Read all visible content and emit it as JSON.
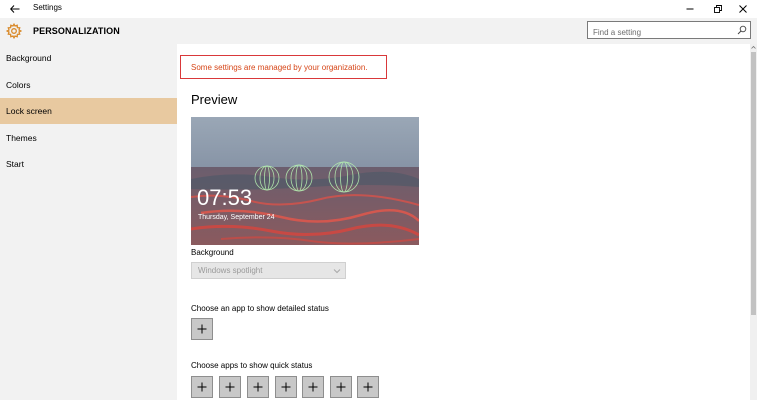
{
  "window": {
    "title": "Settings"
  },
  "header": {
    "heading": "PERSONALIZATION",
    "search_placeholder": "Find a setting"
  },
  "sidebar": {
    "items": [
      {
        "label": "Background"
      },
      {
        "label": "Colors"
      },
      {
        "label": "Lock screen",
        "active": true
      },
      {
        "label": "Themes"
      },
      {
        "label": "Start"
      }
    ]
  },
  "main": {
    "notice": "Some settings are managed by your organization.",
    "preview_title": "Preview",
    "preview": {
      "time": "07:53",
      "date": "Thursday, September 24"
    },
    "background_label": "Background",
    "background_value": "Windows spotlight",
    "detailed_status_label": "Choose an app to show detailed status",
    "quick_status_label": "Choose apps to show quick status"
  },
  "colors": {
    "accent_active": "#e8c9a0",
    "notice_border": "#d9383a",
    "notice_text": "#d64517",
    "gear_icon": "#d98a2a"
  },
  "icons": {
    "back": "back-arrow-icon",
    "settings": "gear-icon",
    "search": "search-icon",
    "add": "plus-icon"
  }
}
